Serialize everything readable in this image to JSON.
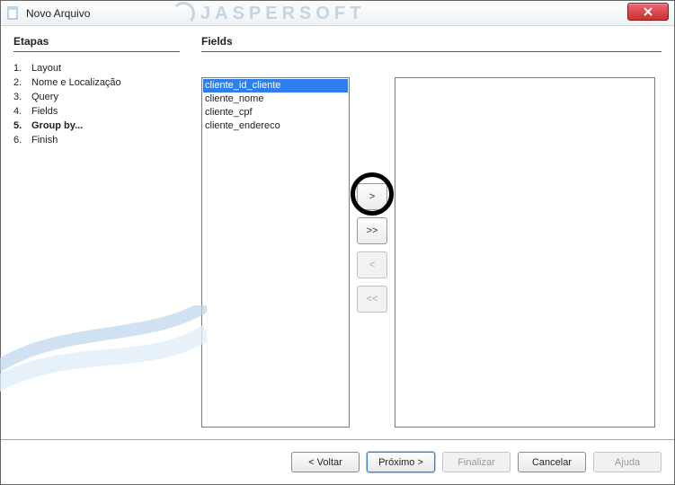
{
  "window": {
    "title": "Novo Arquivo",
    "brand": "JASPERSOFT"
  },
  "sidebar": {
    "title": "Etapas",
    "steps": [
      {
        "num": "1.",
        "label": "Layout"
      },
      {
        "num": "2.",
        "label": "Nome e Localização"
      },
      {
        "num": "3.",
        "label": "Query"
      },
      {
        "num": "4.",
        "label": "Fields"
      },
      {
        "num": "5.",
        "label": "Group by..."
      },
      {
        "num": "6.",
        "label": "Finish"
      }
    ],
    "active_index": 4
  },
  "main": {
    "title": "Fields",
    "source_items": [
      "cliente_id_cliente",
      "cliente_nome",
      "cliente_cpf",
      "cliente_endereco"
    ],
    "selected_source_index": 0,
    "target_items": []
  },
  "transfer": {
    "add": ">",
    "add_all": ">>",
    "remove": "<",
    "remove_all": "<<"
  },
  "footer": {
    "back": "< Voltar",
    "next": "Próximo >",
    "finish": "Finalizar",
    "cancel": "Cancelar",
    "help": "Ajuda"
  }
}
